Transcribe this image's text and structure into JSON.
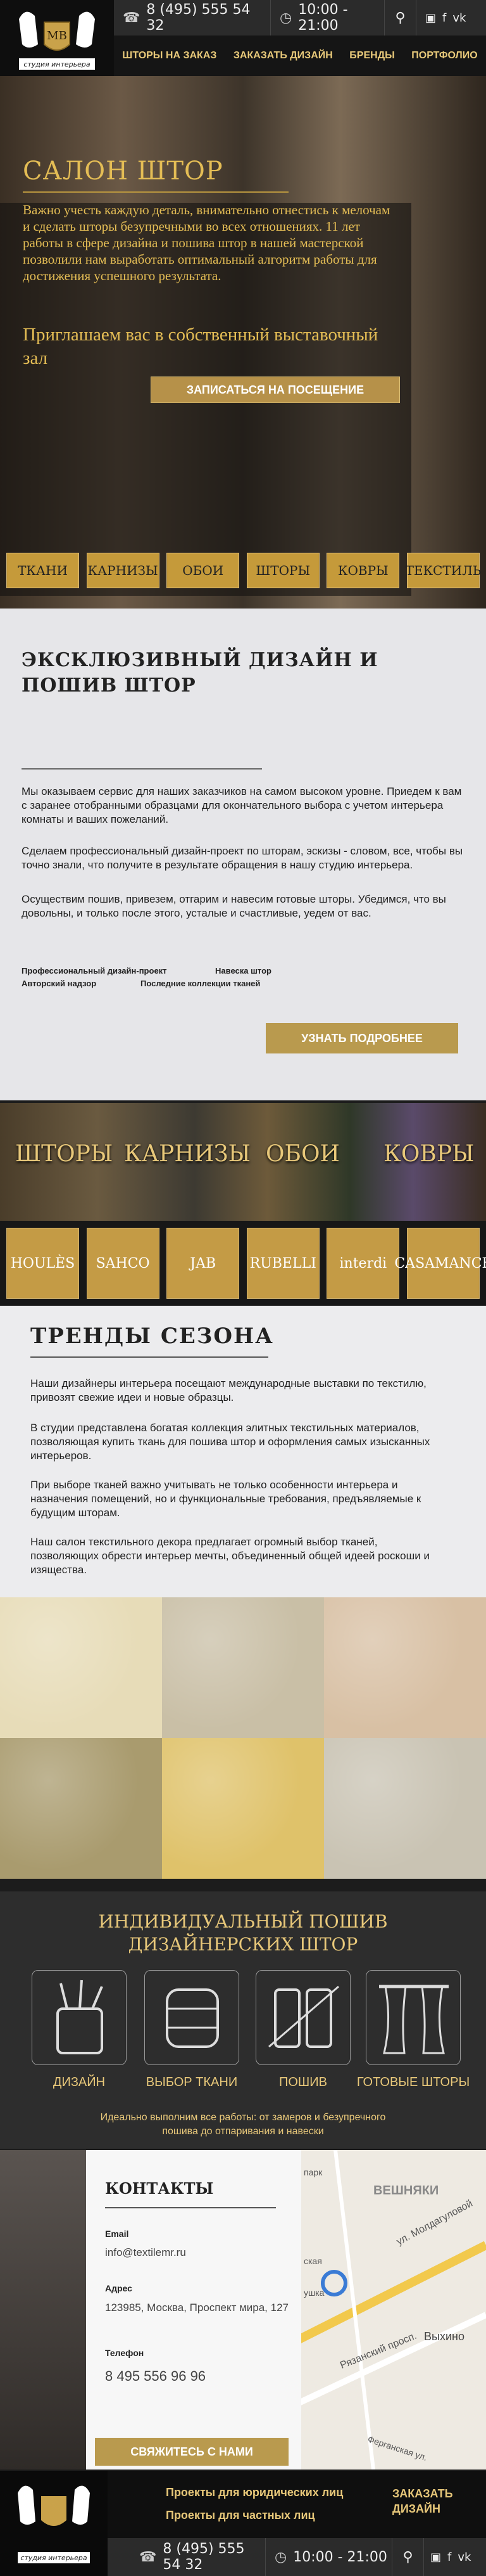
{
  "header": {
    "logo_tagline": "студия интерьера",
    "logo_mark": "МВ",
    "phone": "8 (495) 555 54 32",
    "hours": "10:00 - 21:00",
    "nav": [
      "ШТОРЫ НА ЗАКАЗ",
      "ЗАКАЗАТЬ ДИЗАЙН",
      "БРЕНДЫ",
      "ПОРТФОЛИО"
    ],
    "icons": [
      "phone-icon",
      "clock-icon",
      "location-icon",
      "instagram-icon",
      "facebook-icon",
      "vk-icon"
    ]
  },
  "hero": {
    "title": "САЛОН ШТОР",
    "text": "Важно учесть каждую деталь, внимательно отнестись к мелочам и сделать шторы безупречными во всех отношениях. 11 лет работы в сфере дизайна и пошива штор в нашей мастерской позволили нам выработать оптимальный алгоритм работы для достижения успешного результата.",
    "invite": "Приглашаем вас в собственный выставочный зал",
    "button": "ЗАПИСАТЬСЯ НА ПОСЕЩЕНИЕ",
    "categories": [
      "ТКАНИ",
      "КАРНИЗЫ",
      "ОБОИ",
      "ШТОРЫ",
      "КОВРЫ",
      "ТЕКСТИЛЬ"
    ]
  },
  "design": {
    "title": "ЭКСКЛЮЗИВНЫЙ ДИЗАЙН И ПОШИВ ШТОР",
    "p1": "Мы оказываем сервис для наших заказчиков на самом высоком уровне. Приедем к вам с заранее отобранными образцами для окончательного выбора с учетом интерьера комнаты и ваших пожеланий.",
    "p2": "Сделаем профессиональный дизайн-проект по шторам, эскизы - словом, все, чтобы вы точно знали, что получите в результате обращения в нашу студию интерьера.",
    "p3": "Осуществим пошив, привезем, отгарим и навесим готовые шторы. Убедимся, что вы довольны, и только после этого, усталые и счастливые, уедем от вас.",
    "features": [
      "Профессиональный дизайн-проект",
      "Навеска штор",
      "Авторский надзор",
      "Последние коллекции тканей"
    ],
    "button": "УЗНАТЬ ПОДРОБНЕЕ"
  },
  "photo_row": [
    "ШТОРЫ",
    "КАРНИЗЫ",
    "ОБОИ",
    "КОВРЫ"
  ],
  "brands": [
    "HOULÈS",
    "SAHCO",
    "JAB",
    "RUBELLI",
    "interdi",
    "CASAMANCE"
  ],
  "trends": {
    "title": "ТРЕНДЫ СЕЗОНА",
    "p1": "Наши дизайнеры интерьера посещают международные выставки по текстилю, привозят свежие идеи и новые образцы.",
    "p2": "В студии представлена богатая коллекция элитных текстильных материалов, позволяющая купить ткань для пошива штор и оформления самых изысканных интерьеров.",
    "p3": "При выборе тканей важно учитывать не только особенности интерьера и назначения помещений, но и функциональные требования, предъявляемые к будущим шторам.",
    "p4": "Наш салон текстильного декора предлагает огромный выбор тканей, позволяющих обрести интерьер мечты, объединенный общей идеей роскоши и изящества."
  },
  "fabrics": {
    "colors": [
      "#e7dcb8",
      "#c9bfa6",
      "#d8c0a4",
      "#a99b6e",
      "#dfc26a",
      "#c9c3b3"
    ]
  },
  "service": {
    "title": "ИНДИВИДУАЛЬНЫЙ ПОШИВ ДИЗАЙНЕРСКИХ ШТОР",
    "steps": [
      "ДИЗАЙН",
      "ВЫБОР ТКАНИ",
      "ПОШИВ",
      "ГОТОВЫЕ ШТОРЫ"
    ],
    "note": "Идеально выполним все работы: от замеров и безупречного пошива до отпаривания и навески"
  },
  "contacts": {
    "title": "КОНТАКТЫ",
    "email_label": "Email",
    "email": "info@textilemr.ru",
    "address_label": "Адрес",
    "address": "123985, Москва, Проспект мира, 127",
    "phone_label": "Телефон",
    "phone": "8 495 556 96 96",
    "button": "СВЯЖИТЕСЬ С НАМИ",
    "map_labels": [
      "ВЕШНЯКИ",
      "ул. Молдагуловой",
      "Выхино",
      "Рязанский просп.",
      "Ферганская ул.",
      "парк",
      "ская",
      "ушка"
    ]
  },
  "footer": {
    "links": [
      "Проекты для юридических лиц",
      "Проекты для частных лиц"
    ],
    "order_design": "ЗАКАЗАТЬ ДИЗАЙН",
    "phone": "8 (495) 555 54 32",
    "hours": "10:00 - 21:00",
    "logo_tagline": "студия интерьера"
  }
}
